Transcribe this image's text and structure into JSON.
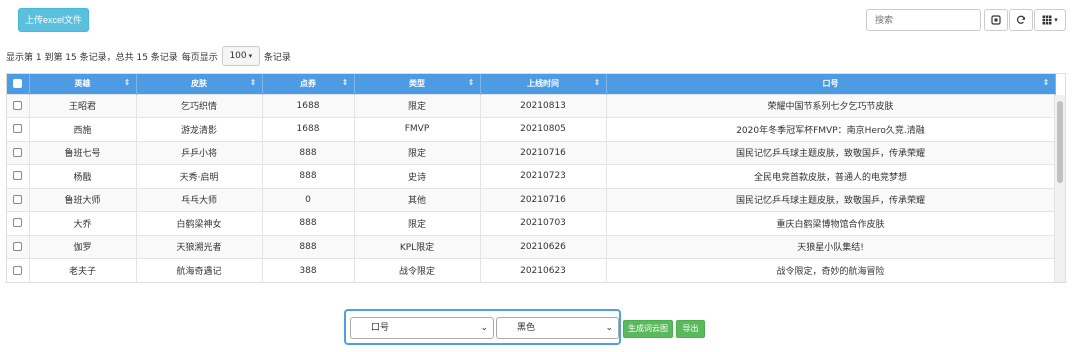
{
  "toolbar": {
    "upload_label": "上传excel文件",
    "search_placeholder": "搜索",
    "refresh_icon": "refresh-icon",
    "toggle_icon": "toggle-view-icon",
    "columns_icon": "columns-icon"
  },
  "pagination": {
    "info": "显示第 1 到第 15 条记录，总共 15 条记录",
    "per_page_prefix": "每页显示",
    "page_size": "100",
    "per_page_suffix": "条记录"
  },
  "table": {
    "columns": [
      "英雄",
      "皮肤",
      "点券",
      "类型",
      "上线时间",
      "口号"
    ],
    "rows": [
      [
        "王昭君",
        "乞巧织情",
        "1688",
        "限定",
        "20210813",
        "荣耀中国节系列七夕乞巧节皮肤"
      ],
      [
        "西施",
        "游龙清影",
        "1688",
        "FMVP",
        "20210805",
        "2020年冬季冠军杯FMVP：南京Hero久竞.清融"
      ],
      [
        "鲁班七号",
        "乒乒小将",
        "888",
        "限定",
        "20210716",
        "国民记忆乒乓球主题皮肤，致敬国乒，传承荣耀"
      ],
      [
        "杨戬",
        "天秀·启明",
        "888",
        "史诗",
        "20210723",
        "全民电竞首款皮肤，普通人的电竞梦想"
      ],
      [
        "鲁班大师",
        "乓乓大师",
        "0",
        "其他",
        "20210716",
        "国民记忆乒乓球主题皮肤，致敬国乒，传承荣耀"
      ],
      [
        "大乔",
        "白鹤梁神女",
        "888",
        "限定",
        "20210703",
        "重庆白鹤梁博物馆合作皮肤"
      ],
      [
        "伽罗",
        "天狼溯光者",
        "888",
        "KPL限定",
        "20210626",
        "天狼星小队集结!"
      ],
      [
        "老夫子",
        "航海奇遇记",
        "388",
        "战令限定",
        "20210623",
        "战令限定，奇妙的航海冒险"
      ]
    ]
  },
  "controls": {
    "field_value": "口号",
    "color_value": "黑色",
    "wordcloud_label": "生成词云图",
    "export_label": "导出"
  },
  "colors": {
    "header_blue": "#4d9be3",
    "info_button": "#5bc0de",
    "success_button": "#5cb85c",
    "panel_border": "#4fa3d9"
  }
}
